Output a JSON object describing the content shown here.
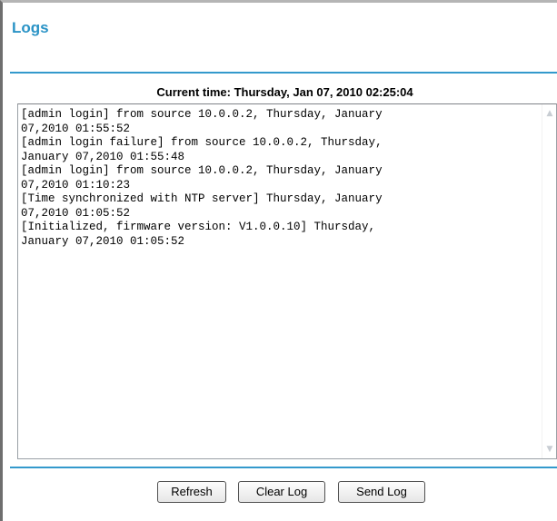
{
  "page": {
    "title": "Logs",
    "current_time": "Current time: Thursday, Jan 07, 2010 02:25:04"
  },
  "log": {
    "text": "[admin login] from source 10.0.0.2, Thursday, January\n07,2010 01:55:52\n[admin login failure] from source 10.0.0.2, Thursday,\nJanuary 07,2010 01:55:48\n[admin login] from source 10.0.0.2, Thursday, January\n07,2010 01:10:23\n[Time synchronized with NTP server] Thursday, January\n07,2010 01:05:52\n[Initialized, firmware version: V1.0.0.10] Thursday,\nJanuary 07,2010 01:05:52"
  },
  "scrollbar": {
    "up_icon": "▲",
    "down_icon": "▼"
  },
  "buttons": {
    "refresh": "Refresh",
    "clear_log": "Clear Log",
    "send_log": "Send Log"
  },
  "colors": {
    "accent": "#2a93c6",
    "rule": "#3399cc"
  }
}
